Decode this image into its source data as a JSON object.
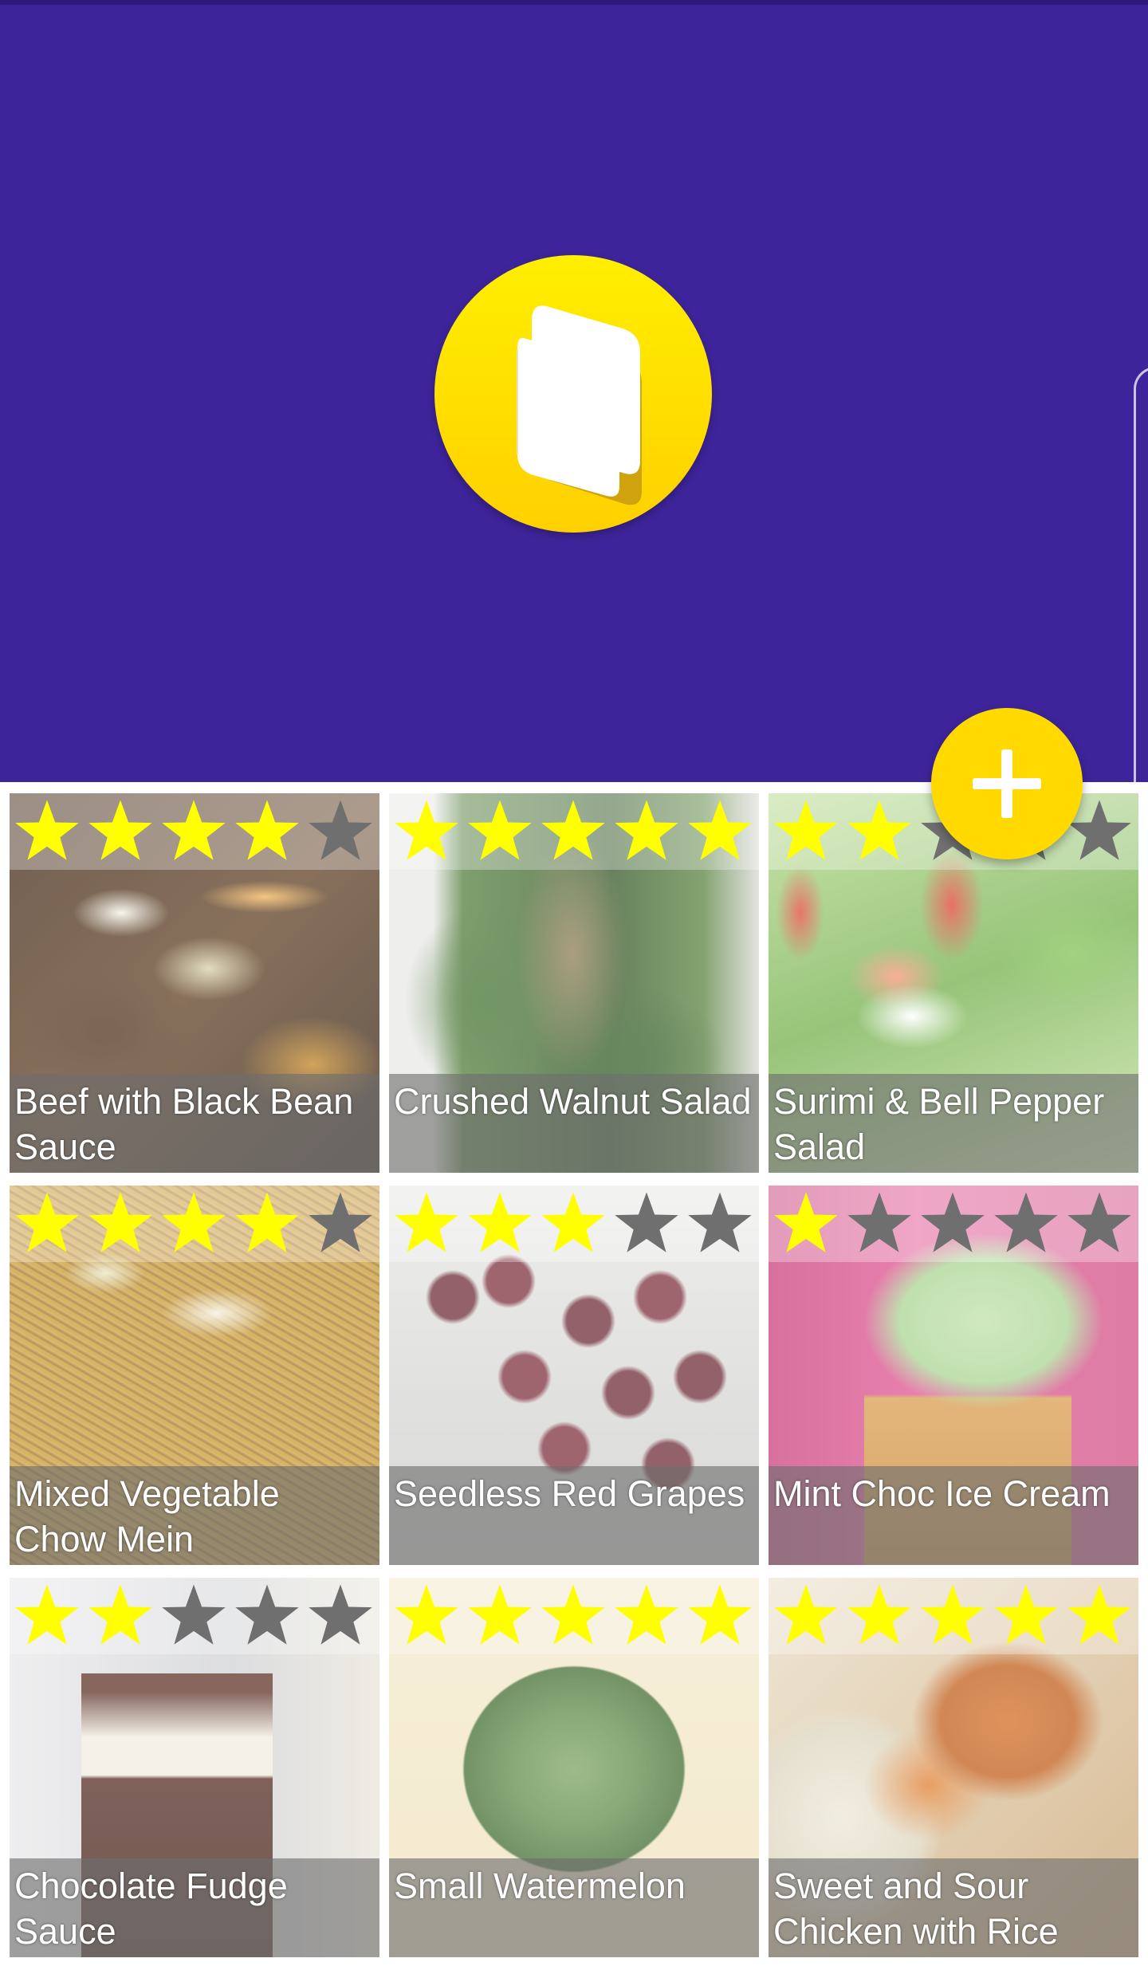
{
  "app": {
    "logo_icon": "book-icon",
    "accent": "#ffd900",
    "header_color": "#3e249a"
  },
  "fab": {
    "icon": "plus-icon"
  },
  "recipes": [
    {
      "name": "Beef with Black Bean Sauce",
      "rating": 4
    },
    {
      "name": "Crushed Walnut Salad",
      "rating": 5
    },
    {
      "name": "Surimi & Bell Pepper Salad",
      "rating": 2
    },
    {
      "name": "Mixed Vegetable Chow Mein",
      "rating": 4
    },
    {
      "name": "Seedless Red Grapes",
      "rating": 3
    },
    {
      "name": "Mint Choc Ice Cream",
      "rating": 1
    },
    {
      "name": "Chocolate Fudge Sauce",
      "rating": 2
    },
    {
      "name": "Small Watermelon",
      "rating": 5
    },
    {
      "name": "Sweet and Sour Chicken with Rice",
      "rating": 5
    }
  ]
}
